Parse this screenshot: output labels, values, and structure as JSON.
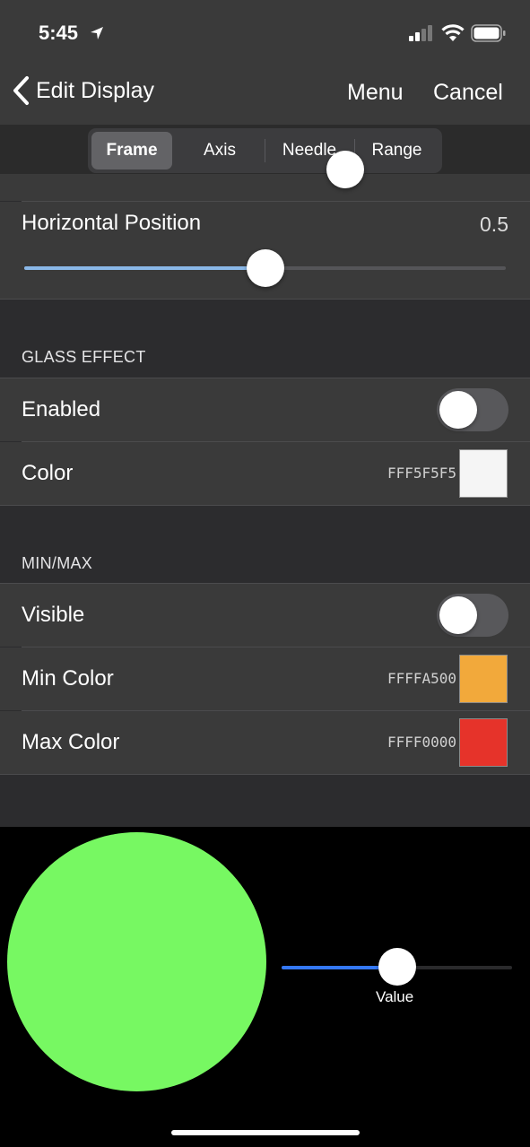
{
  "status_bar": {
    "time": "5:45",
    "icons": [
      "location-arrow-icon",
      "signal-icon",
      "wifi-icon",
      "battery-icon"
    ]
  },
  "nav": {
    "back_label": "Edit Display",
    "menu_label": "Menu",
    "cancel_label": "Cancel"
  },
  "tabs": [
    {
      "label": "Frame",
      "selected": true
    },
    {
      "label": "Axis",
      "selected": false
    },
    {
      "label": "Needle",
      "selected": false
    },
    {
      "label": "Range",
      "selected": false
    }
  ],
  "horizontal_position": {
    "label": "Horizontal Position",
    "value": "0.5",
    "fraction": 0.5
  },
  "glass_effect": {
    "header": "GLASS EFFECT",
    "enabled": {
      "label": "Enabled",
      "on": false
    },
    "color": {
      "label": "Color",
      "hex": "FFF5F5F5",
      "swatch": "#F5F5F5"
    }
  },
  "min_max": {
    "header": "MIN/MAX",
    "visible": {
      "label": "Visible",
      "on": false
    },
    "min_color": {
      "label": "Min Color",
      "hex": "FFFFA500",
      "swatch": "#F2A93B"
    },
    "max_color": {
      "label": "Max Color",
      "hex": "FFFF0000",
      "swatch": "#E6332A"
    }
  },
  "preview": {
    "gauge_color": "#77F862",
    "value_label": "Value",
    "value_fraction": 0.5
  },
  "colors": {
    "accent_slider": "#8AB8E8",
    "preview_slider": "#3478F6"
  }
}
